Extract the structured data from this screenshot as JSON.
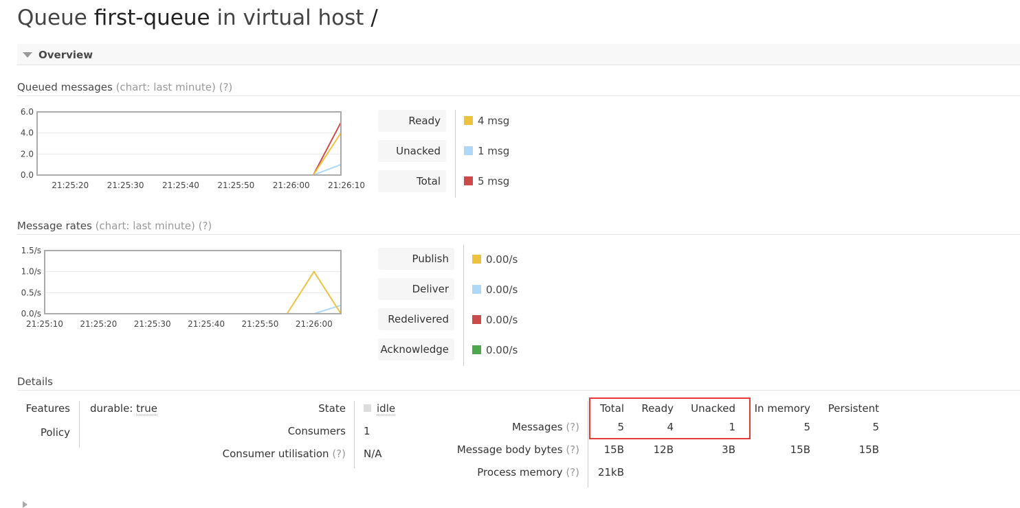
{
  "page": {
    "title_prefix": "Queue ",
    "queue_name": "first-queue",
    "title_mid": " in virtual host ",
    "vhost": "/"
  },
  "overview": {
    "label": "Overview"
  },
  "queued_messages": {
    "heading": "Queued messages",
    "heading_note": "(chart: last minute) (?)",
    "legend": [
      {
        "label": "Ready",
        "value": "4 msg",
        "color": "#edc240"
      },
      {
        "label": "Unacked",
        "value": "1 msg",
        "color": "#afd8f8"
      },
      {
        "label": "Total",
        "value": "5 msg",
        "color": "#cb4b4b"
      }
    ]
  },
  "message_rates": {
    "heading": "Message rates",
    "heading_note": "(chart: last minute) (?)",
    "legend": [
      {
        "label": "Publish",
        "value": "0.00/s",
        "color": "#edc240"
      },
      {
        "label": "Deliver",
        "value": "0.00/s",
        "color": "#afd8f8"
      },
      {
        "label": "Redelivered",
        "value": "0.00/s",
        "color": "#cb4b4b"
      },
      {
        "label": "Acknowledge",
        "value": "0.00/s",
        "color": "#4da74d"
      }
    ]
  },
  "chart_data": [
    {
      "type": "line",
      "title": "Queued messages",
      "x": [
        "21:25:14",
        "21:26:04",
        "21:26:09"
      ],
      "x_ticks": [
        "21:25:20",
        "21:25:30",
        "21:25:40",
        "21:25:50",
        "21:26:00",
        "21:26:10"
      ],
      "y_ticks": [
        "0.0",
        "2.0",
        "4.0",
        "6.0"
      ],
      "ylim": [
        0,
        6
      ],
      "series": [
        {
          "name": "Ready",
          "color": "#edc240",
          "values": [
            0,
            0,
            4
          ]
        },
        {
          "name": "Unacked",
          "color": "#afd8f8",
          "values": [
            0,
            0,
            1
          ]
        },
        {
          "name": "Total",
          "color": "#cb4b4b",
          "values": [
            0,
            0,
            5
          ]
        }
      ]
    },
    {
      "type": "line",
      "title": "Message rates",
      "x": [
        "21:25:10",
        "21:25:55",
        "21:26:00",
        "21:26:05"
      ],
      "x_ticks": [
        "21:25:10",
        "21:25:20",
        "21:25:30",
        "21:25:40",
        "21:25:50",
        "21:26:00"
      ],
      "y_ticks": [
        "0.0/s",
        "0.5/s",
        "1.0/s",
        "1.5/s"
      ],
      "ylim": [
        0,
        1.5
      ],
      "series": [
        {
          "name": "Publish",
          "color": "#edc240",
          "values": [
            0,
            0,
            1.0,
            0
          ]
        },
        {
          "name": "Deliver",
          "color": "#afd8f8",
          "values": [
            0,
            0,
            0,
            0.2
          ]
        },
        {
          "name": "Redelivered",
          "color": "#cb4b4b",
          "values": [
            0,
            0,
            0,
            0
          ]
        },
        {
          "name": "Acknowledge",
          "color": "#4da74d",
          "values": [
            0,
            0,
            0,
            0
          ]
        }
      ]
    }
  ],
  "details": {
    "heading": "Details",
    "features_label": "Features",
    "features_key": "durable:",
    "features_value": "true",
    "policy_label": "Policy",
    "state_label": "State",
    "state_value": "idle",
    "consumers_label": "Consumers",
    "consumers_value": "1",
    "utilisation_label": "Consumer utilisation",
    "utilisation_help": "(?)",
    "utilisation_value": "N/A",
    "stats": {
      "columns": [
        "Total",
        "Ready",
        "Unacked",
        "In memory",
        "Persistent"
      ],
      "rows": [
        {
          "label": "Messages",
          "help": "(?)",
          "values": [
            "5",
            "4",
            "1",
            "5",
            "5"
          ]
        },
        {
          "label": "Message body bytes",
          "help": "(?)",
          "values": [
            "15B",
            "12B",
            "3B",
            "15B",
            "15B"
          ]
        },
        {
          "label": "Process memory",
          "help": "(?)",
          "values": [
            "21kB",
            "",
            "",
            "",
            ""
          ]
        }
      ]
    }
  }
}
